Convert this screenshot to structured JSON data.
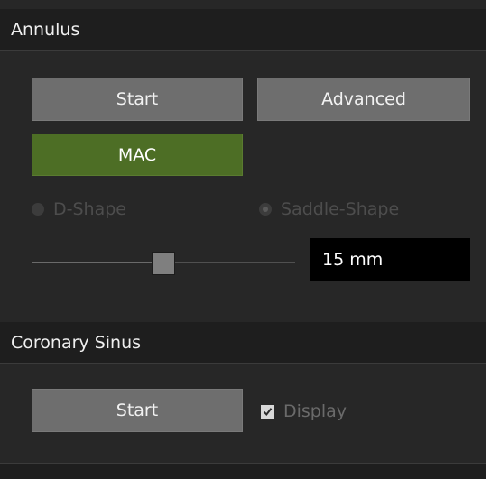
{
  "annulus": {
    "title": "Annulus",
    "start_label": "Start",
    "advanced_label": "Advanced",
    "mac_label": "MAC",
    "mac_color": "#4d6e25",
    "shape_options": [
      {
        "label": "D-Shape",
        "checked": false,
        "enabled": false
      },
      {
        "label": "Saddle-Shape",
        "checked": true,
        "enabled": false
      }
    ],
    "slider_value": 0.5,
    "value_text": "15 mm"
  },
  "coronary_sinus": {
    "title": "Coronary Sinus",
    "start_label": "Start",
    "display_label": "Display",
    "display_checked": true,
    "display_enabled": false
  }
}
